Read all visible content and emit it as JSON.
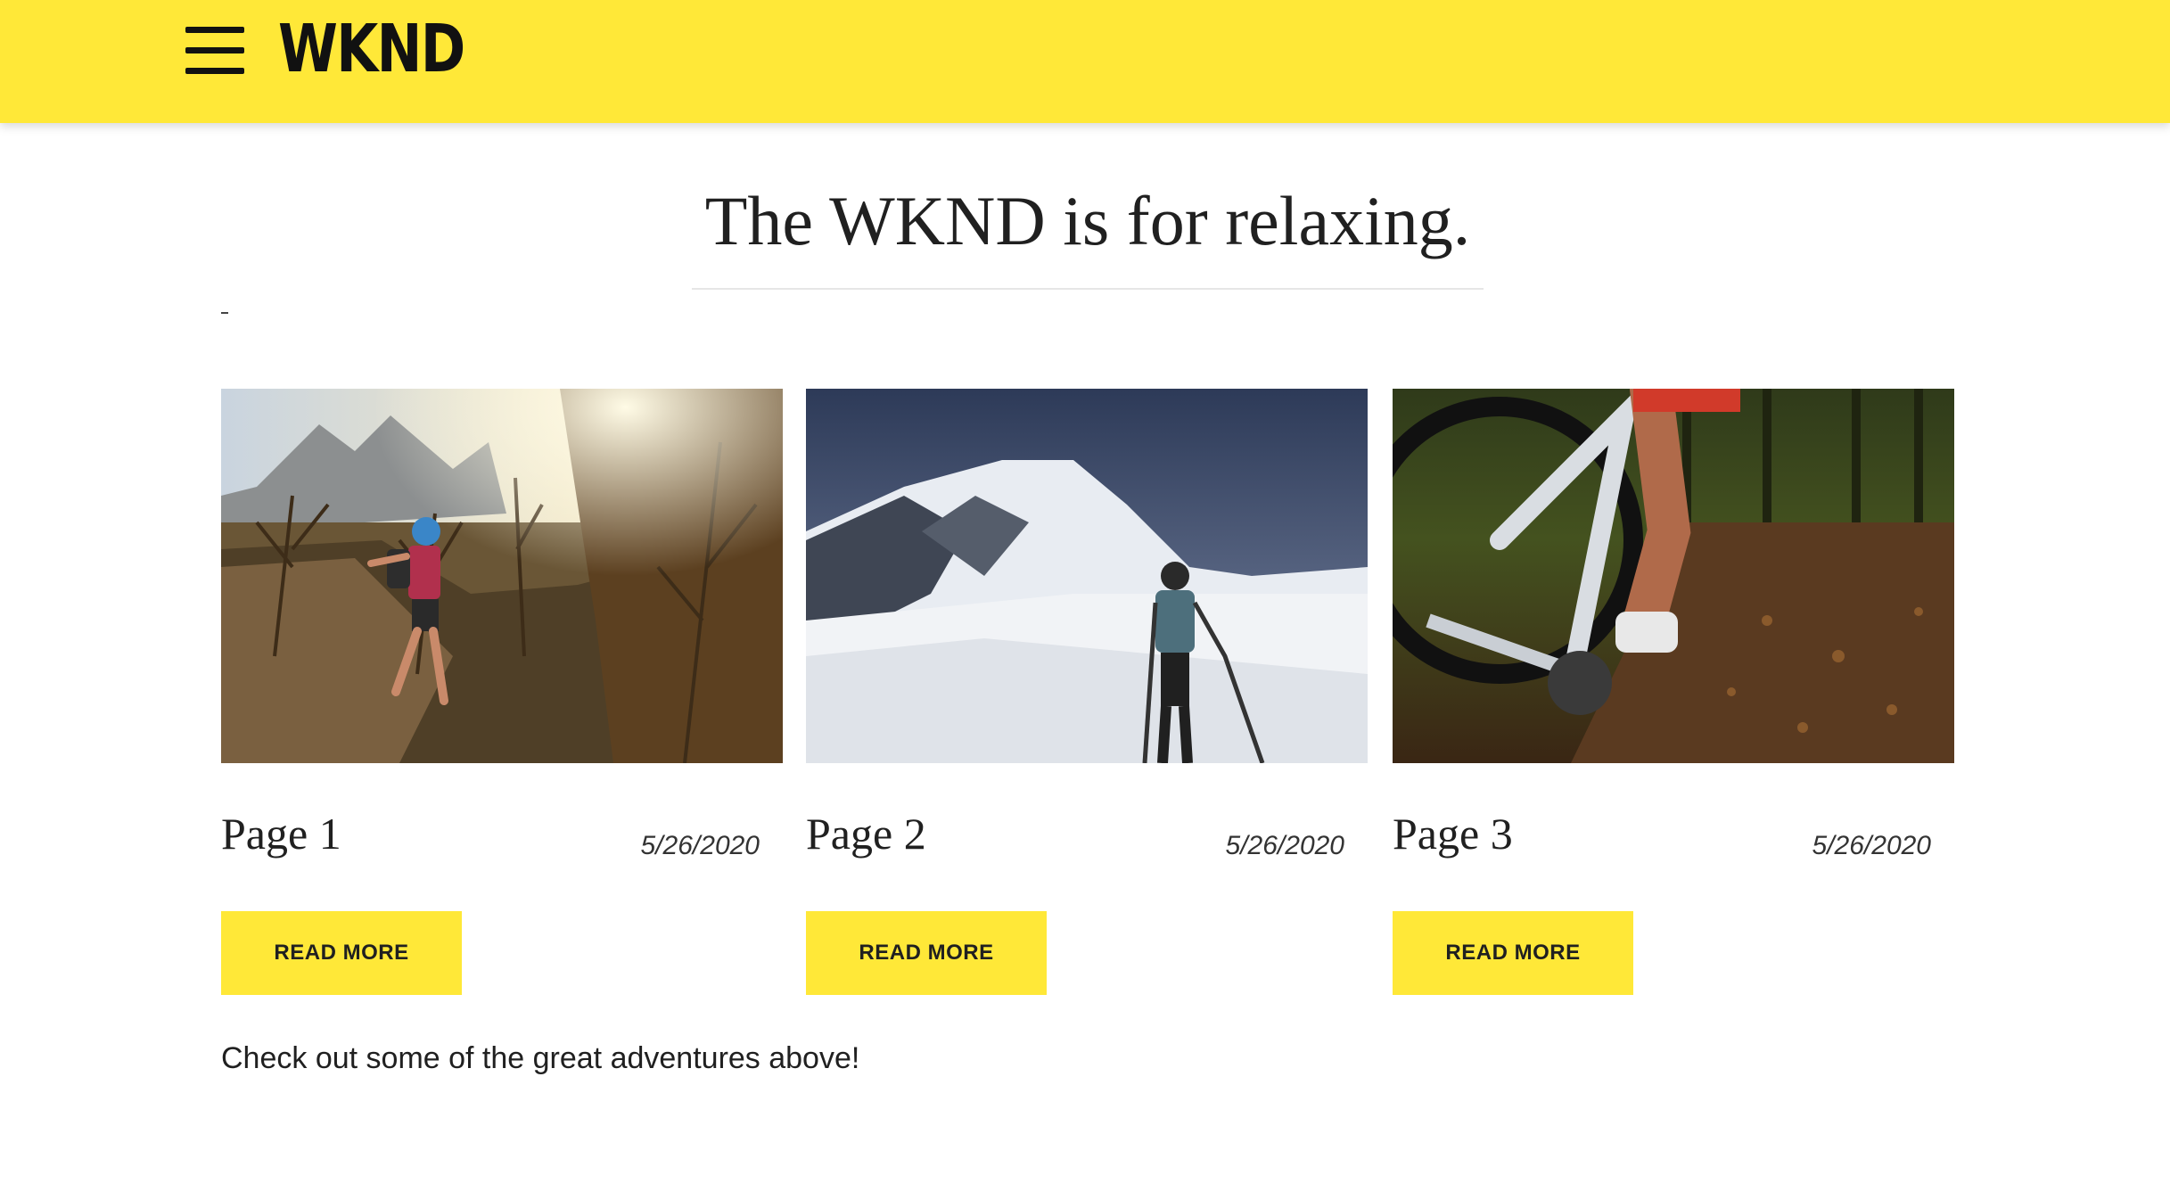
{
  "header": {
    "logo": "WKND",
    "menu_icon": "hamburger-menu-icon",
    "background_color": "#ffe838"
  },
  "main": {
    "title": "The WKND is for relaxing.",
    "cards": [
      {
        "title": "Page 1",
        "date": "5/26/2020",
        "button_label": "READ MORE",
        "image": "hiker-in-sunny-autumn-forest"
      },
      {
        "title": "Page 2",
        "date": "5/26/2020",
        "button_label": "READ MORE",
        "image": "climber-on-snowy-mountain"
      },
      {
        "title": "Page 3",
        "date": "5/26/2020",
        "button_label": "READ MORE",
        "image": "mountain-bike-on-forest-trail"
      }
    ],
    "footer_text": "Check out some of the great adventures above!"
  }
}
